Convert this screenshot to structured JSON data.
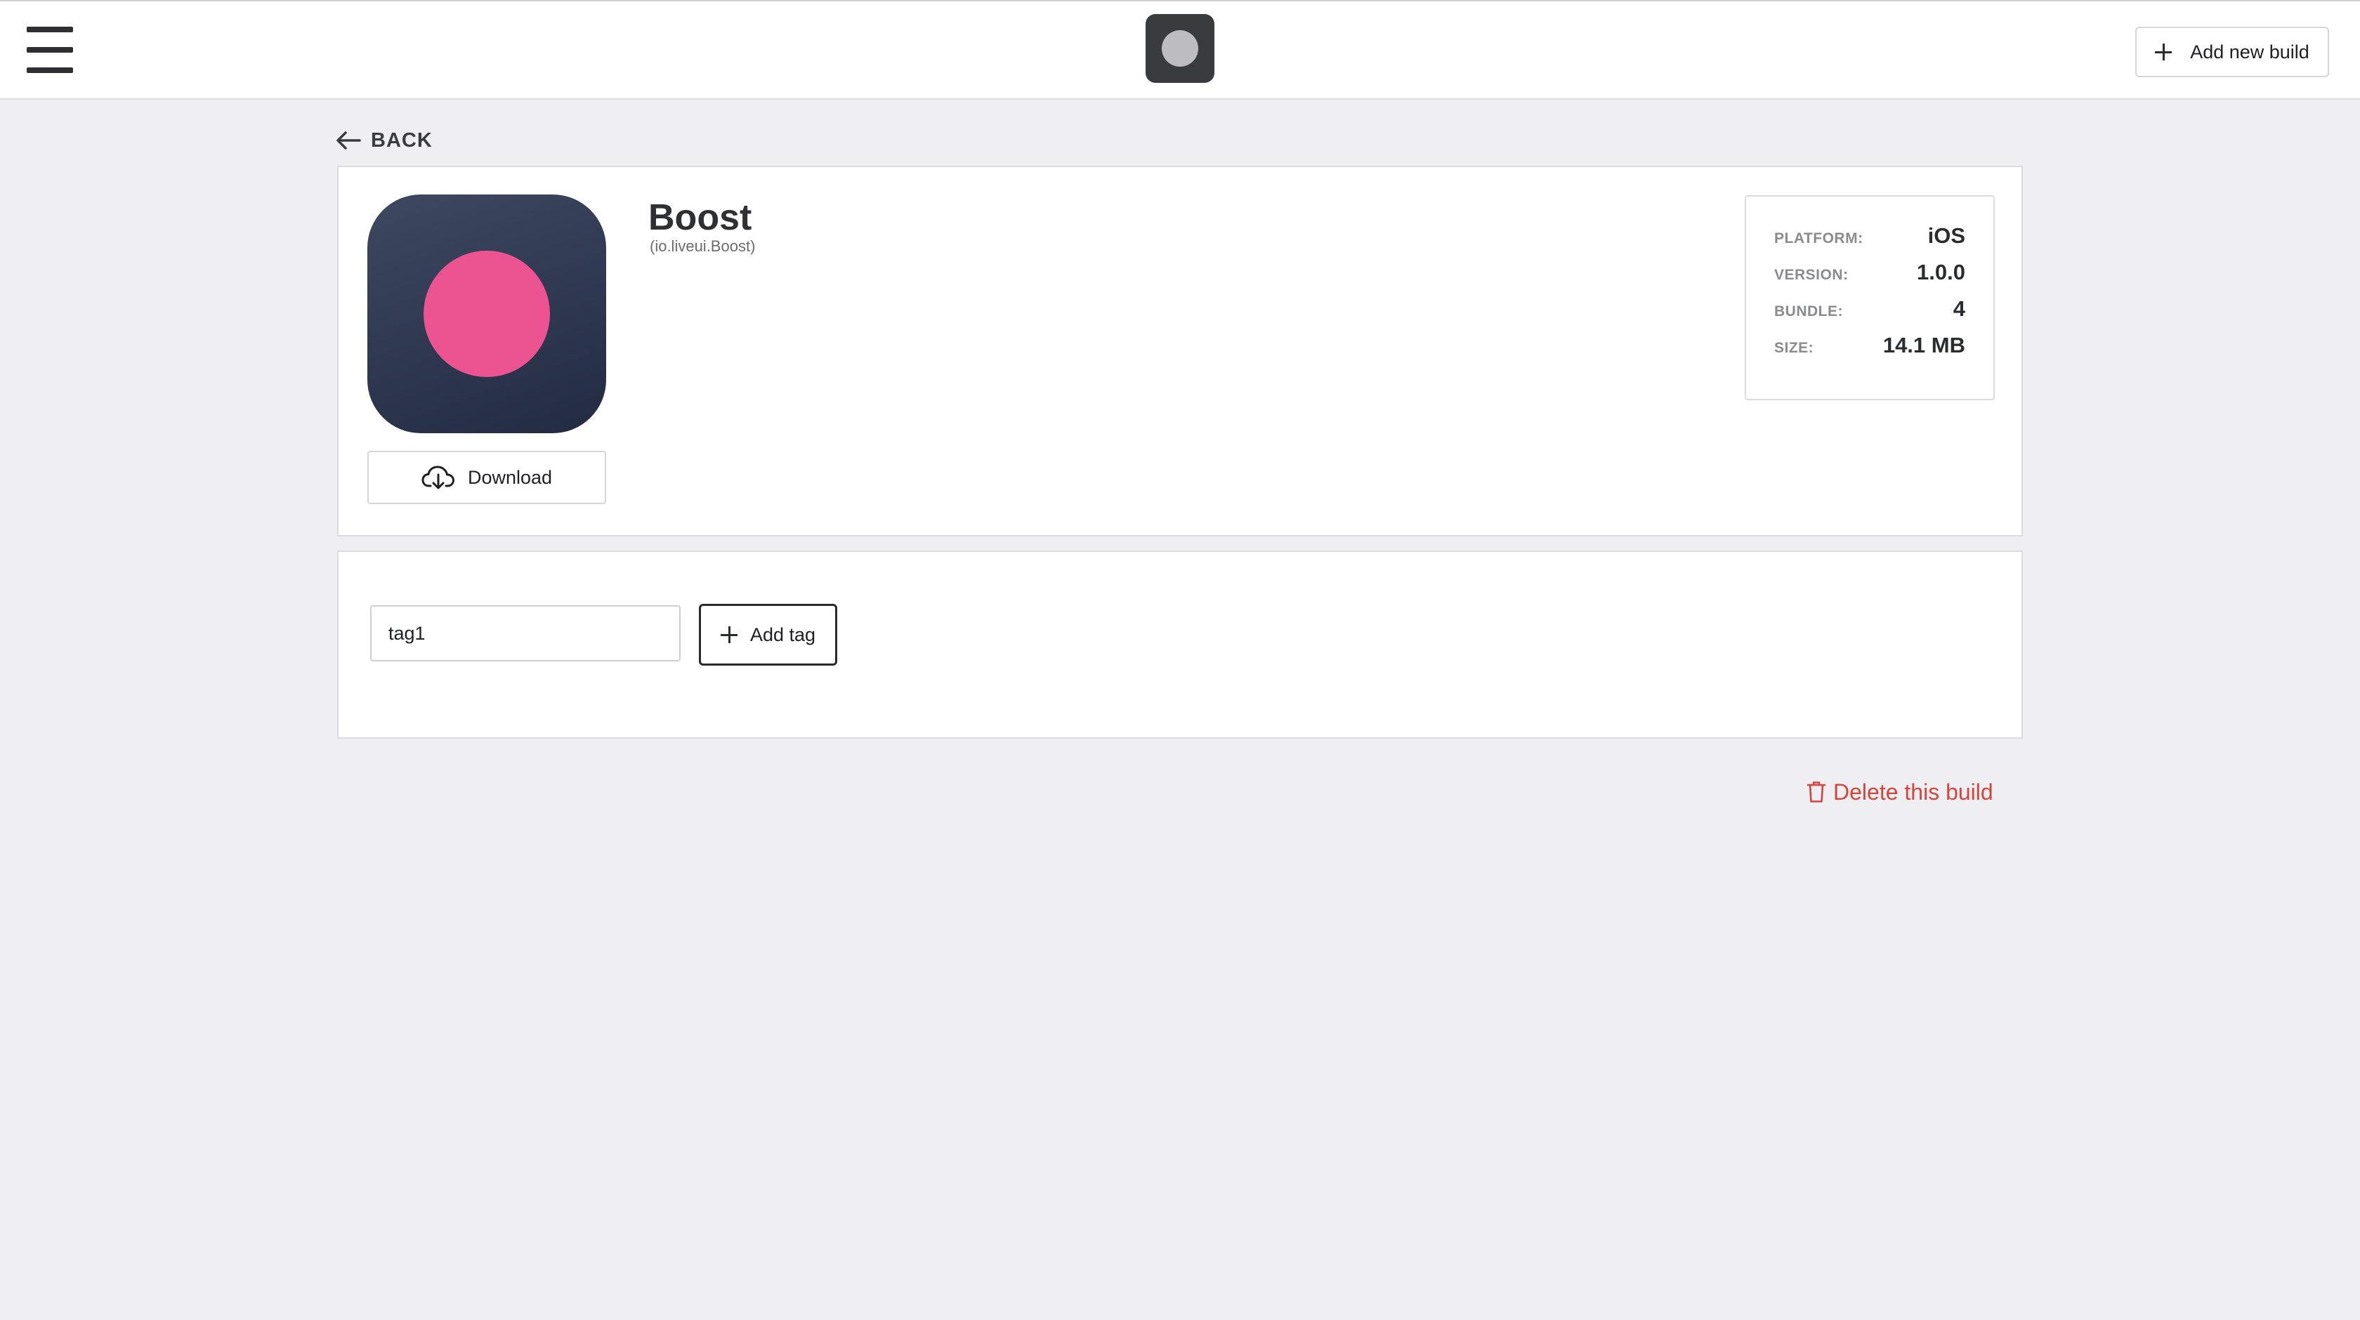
{
  "header": {
    "add_build_label": "Add new build"
  },
  "nav": {
    "back_label": "BACK"
  },
  "app": {
    "name": "Boost",
    "bundle_id": "(io.liveui.Boost)",
    "download_label": "Download",
    "icon_colors": {
      "background": "#2b344c",
      "dot": "#ec5491"
    }
  },
  "info": [
    {
      "label": "PLATFORM:",
      "value": "iOS"
    },
    {
      "label": "VERSION:",
      "value": "1.0.0"
    },
    {
      "label": "BUNDLE:",
      "value": "4"
    },
    {
      "label": "SIZE:",
      "value": "14.1 MB"
    }
  ],
  "tags": {
    "input_value": "tag1",
    "add_tag_label": "Add tag"
  },
  "actions": {
    "delete_label": "Delete this build"
  },
  "colors": {
    "page_background": "#efeff3",
    "danger": "#d4453c"
  }
}
